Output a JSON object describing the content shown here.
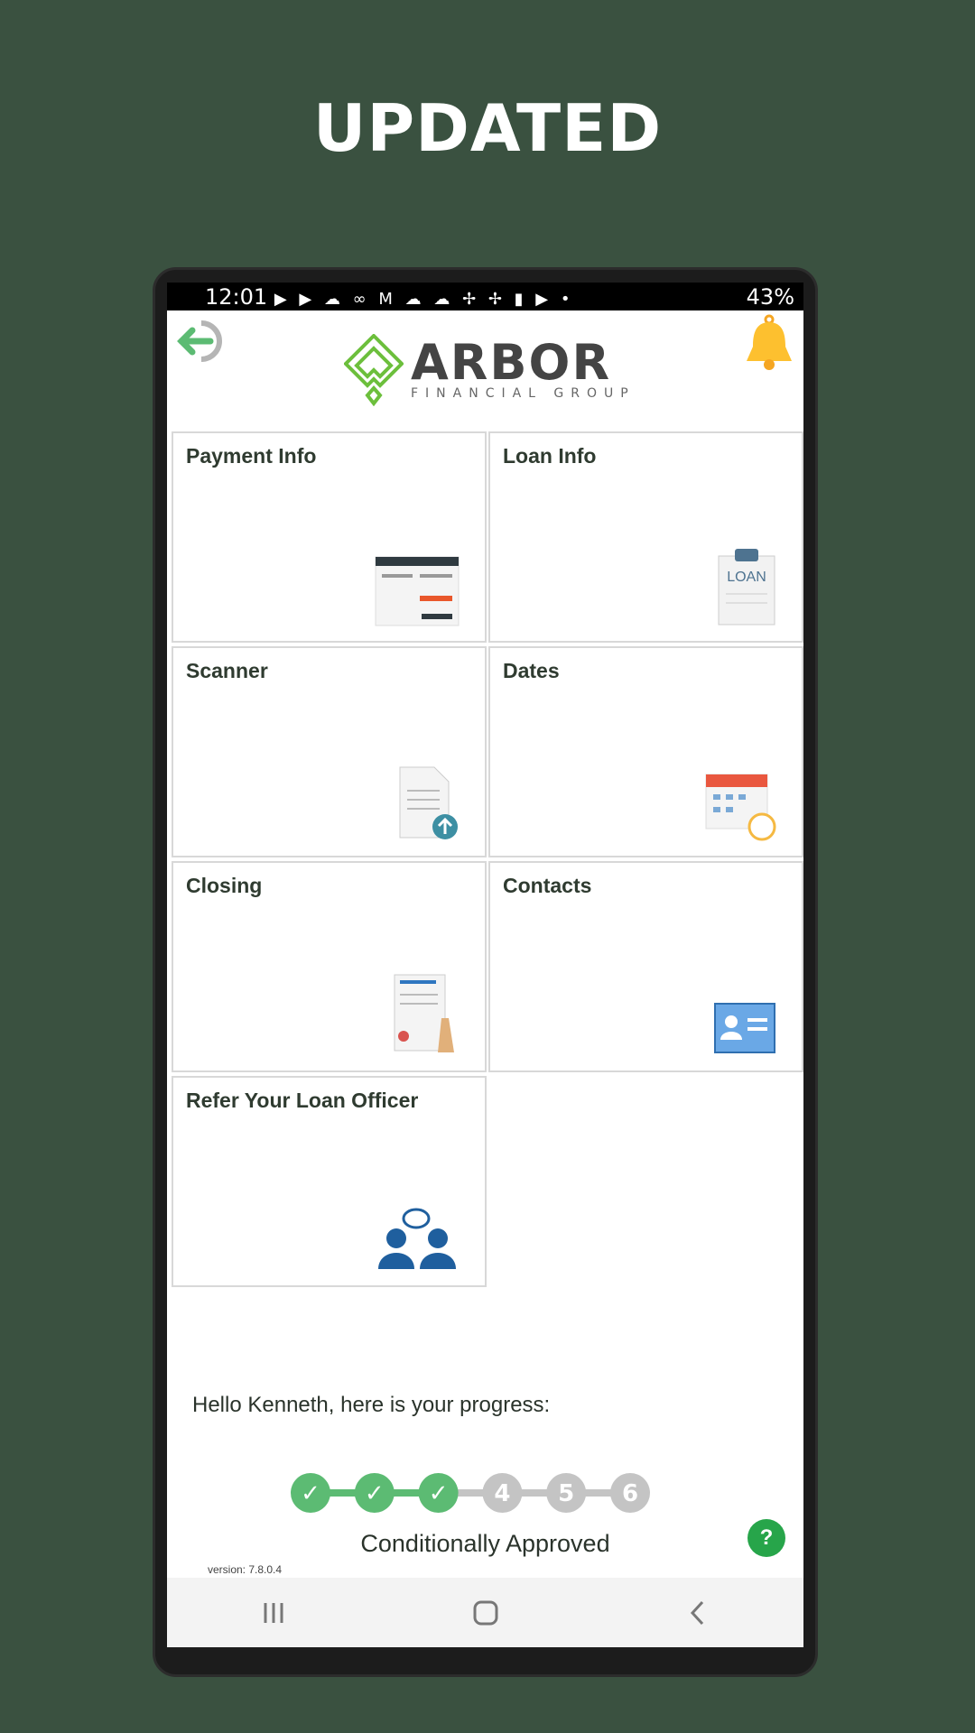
{
  "headline": "UPDATED",
  "status_bar": {
    "time": "12:01",
    "battery": "43%",
    "icons": "▶ ▶ ☁ ∞ M ☁ ☁ ✢ ✢ ▮ ▶ •"
  },
  "header": {
    "brand": "ARBOR",
    "brand_sub": "FINANCIAL GROUP",
    "logout_icon": "logout-icon",
    "bell_icon": "bell-icon"
  },
  "tiles": [
    {
      "label": "Payment Info",
      "icon": "payment-form-icon"
    },
    {
      "label": "Loan Info",
      "icon": "loan-clipboard-icon"
    },
    {
      "label": "Scanner",
      "icon": "document-upload-icon"
    },
    {
      "label": "Dates",
      "icon": "calendar-clock-icon"
    },
    {
      "label": "Closing",
      "icon": "signed-document-icon"
    },
    {
      "label": "Contacts",
      "icon": "contact-card-icon"
    },
    {
      "label": "Refer Your Loan Officer",
      "icon": "people-chat-icon"
    }
  ],
  "progress": {
    "greeting": "Hello Kenneth, here is your progress:",
    "completed": 3,
    "total": 6,
    "steps": [
      "✓",
      "✓",
      "✓",
      "4",
      "5",
      "6"
    ],
    "status": "Conditionally Approved",
    "complete_color": "#5cbb73",
    "pending_color": "#c4c4c4"
  },
  "help_label": "?",
  "version": "version: 7.8.0.4"
}
